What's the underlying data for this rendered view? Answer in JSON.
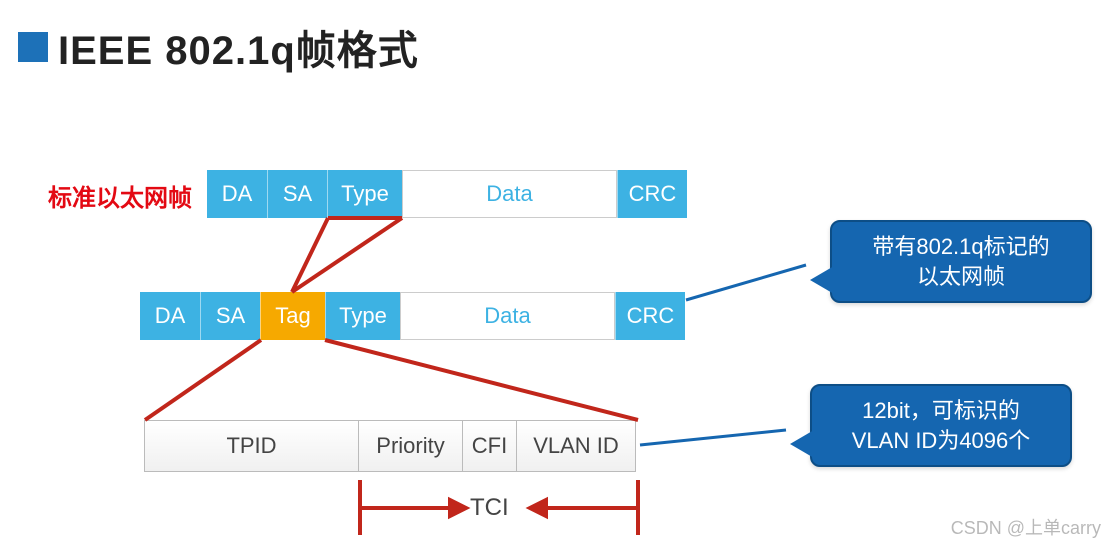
{
  "title": "IEEE 802.1q帧格式",
  "standard_frame_label": "标准以太网帧",
  "frame1": {
    "da": "DA",
    "sa": "SA",
    "type": "Type",
    "data": "Data",
    "crc": "CRC"
  },
  "frame2": {
    "da": "DA",
    "sa": "SA",
    "tag": "Tag",
    "type": "Type",
    "data": "Data",
    "crc": "CRC"
  },
  "tag_fields": {
    "tpid": "TPID",
    "priority": "Priority",
    "cfi": "CFI",
    "vlanid": "VLAN ID"
  },
  "tci_label": "TCI",
  "callout1": {
    "line1": "带有802.1q标记的",
    "line2": "以太网帧"
  },
  "callout2": {
    "line1": "12bit，可标识的",
    "line2": "VLAN ID为4096个"
  },
  "watermark": "CSDN @上单carry",
  "colors": {
    "blue_cell": "#3db2e3",
    "tag_cell": "#f6a900",
    "callout": "#1566b0",
    "accent_red": "#c1261b",
    "title_bullet": "#1d71b8",
    "label_red": "#e30913"
  }
}
